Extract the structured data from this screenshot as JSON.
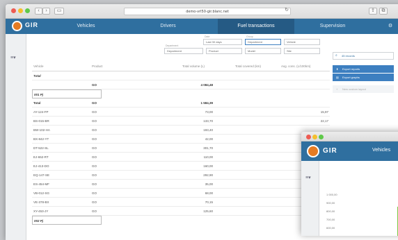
{
  "browser": {
    "url": "demo-vrl50-gir.blanc.net"
  },
  "app": {
    "logo": "GIR",
    "tabs": [
      "Vehicles",
      "Drivers",
      "Fuel transactions",
      "Supervision"
    ],
    "active_tab": 2
  },
  "filters": {
    "period": {
      "label": "Date",
      "value": "Last 30 days"
    },
    "group": {
      "label": "Group",
      "value": "Department"
    },
    "vehicle": {
      "value": "Vehicle"
    },
    "department": {
      "label": "Department",
      "value": "Department"
    },
    "product": {
      "value": "Product"
    },
    "model": {
      "value": "Model"
    },
    "site": {
      "value": "Site"
    }
  },
  "sidebar": {
    "records": "45 records",
    "export": "Export reports",
    "print": "Export graphs",
    "new": "New custom layout"
  },
  "table": {
    "headers": [
      "Vehicle",
      "Product",
      "Total volume (L)",
      "Total covered (km)",
      "Avg. cons. (L/100km)"
    ],
    "rows": [
      {
        "type": "section",
        "vehicle": "Total"
      },
      {
        "type": "total",
        "vehicle": "",
        "product": "GO",
        "volume": "4 084,48",
        "cons": ""
      },
      {
        "type": "group",
        "vehicle": "001 Pj"
      },
      {
        "type": "total",
        "vehicle": "Total",
        "product": "GO",
        "volume": "1 584,39",
        "cons": ""
      },
      {
        "type": "data",
        "vehicle": "AY-124-FP",
        "product": "GO",
        "volume": "73,00",
        "cons": "15,97"
      },
      {
        "type": "data",
        "vehicle": "BS-015-BR",
        "product": "GO",
        "volume": "133,70",
        "cons": "22,17"
      },
      {
        "type": "data",
        "vehicle": "BW-102-HA",
        "product": "GO",
        "volume": "193,40",
        "cons": ""
      },
      {
        "type": "data",
        "vehicle": "BX-842-YT",
        "product": "GO",
        "volume": "42,00",
        "cons": ""
      },
      {
        "type": "data",
        "vehicle": "DT-522-SL",
        "product": "GO",
        "volume": "301,70",
        "cons": ""
      },
      {
        "type": "data",
        "vehicle": "EJ-652-RT",
        "product": "GO",
        "volume": "110,00",
        "cons": ""
      },
      {
        "type": "data",
        "vehicle": "EJ-413-DO",
        "product": "GO",
        "volume": "160,00",
        "cons": ""
      },
      {
        "type": "data",
        "vehicle": "EQ-147-SE",
        "product": "GO",
        "volume": "292,90",
        "cons": ""
      },
      {
        "type": "data",
        "vehicle": "ES-454-MF",
        "product": "GO",
        "volume": "35,00",
        "cons": ""
      },
      {
        "type": "data",
        "vehicle": "VB-012-SG",
        "product": "GO",
        "volume": "68,00",
        "cons": ""
      },
      {
        "type": "data",
        "vehicle": "VE-378-BX",
        "product": "GO",
        "volume": "70,15",
        "cons": ""
      },
      {
        "type": "data",
        "vehicle": "XY-453-JY",
        "product": "GO",
        "volume": "125,60",
        "cons": ""
      },
      {
        "type": "group",
        "vehicle": "002 Pj"
      }
    ]
  },
  "second_window": {
    "logo": "GIR",
    "tab": "Vehicles",
    "ticks": [
      "1 000,00",
      "900,00",
      "800,00",
      "700,00",
      "600,00"
    ]
  }
}
